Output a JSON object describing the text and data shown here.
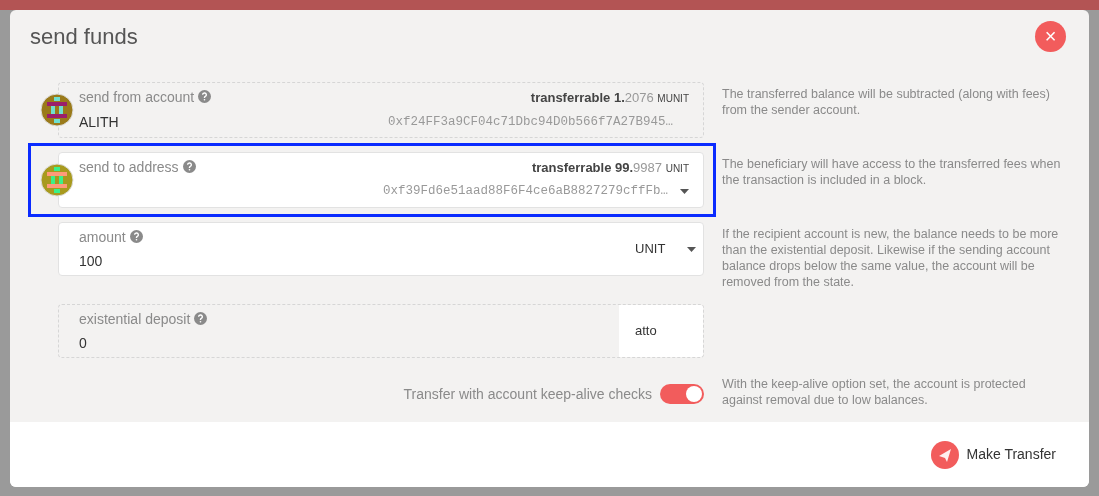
{
  "dialog": {
    "title": "send funds",
    "close_icon": "×"
  },
  "sections": [
    {
      "kind": "account",
      "label": "send from account",
      "value": "ALITH",
      "balance_label": "transferrable",
      "balance_int": "1.",
      "balance_dec": "2076",
      "balance_unit": "MUNIT",
      "address": "0xf24FF3a9CF04c71Dbc94D0b566f7A27B945…",
      "editable": false,
      "dropdown": false,
      "highlighted": false,
      "help": "The transferred balance will be subtracted (along with fees) from the sender account."
    },
    {
      "kind": "account",
      "label": "send to address",
      "balance_label": "transferrable",
      "balance_int": "99.",
      "balance_dec": "9987",
      "balance_unit": "UNIT",
      "address": "0xf39Fd6e51aad88F6F4ce6aB8827279cffFb…",
      "editable": true,
      "dropdown": true,
      "highlighted": true,
      "help": "The beneficiary will have access to the transferred fees when the transaction is included in a block."
    },
    {
      "kind": "amount",
      "label": "amount",
      "value": "100",
      "unit": "UNIT",
      "editable": true,
      "dropdown": true,
      "highlighted": false,
      "help": "If the recipient account is new, the balance needs to be more than the existential deposit. Likewise if the sending account balance drops below the same value, the account will be removed from the state."
    },
    {
      "kind": "amount",
      "label": "existential deposit",
      "value": "0",
      "unit": "atto",
      "editable": false,
      "dropdown": false,
      "highlighted": false
    },
    {
      "kind": "toggle",
      "label": "Transfer with account keep-alive checks",
      "on": true,
      "help": "With the keep-alive option set, the account is protected against removal due to low balances."
    }
  ],
  "footer": {
    "button": "Make Transfer"
  }
}
